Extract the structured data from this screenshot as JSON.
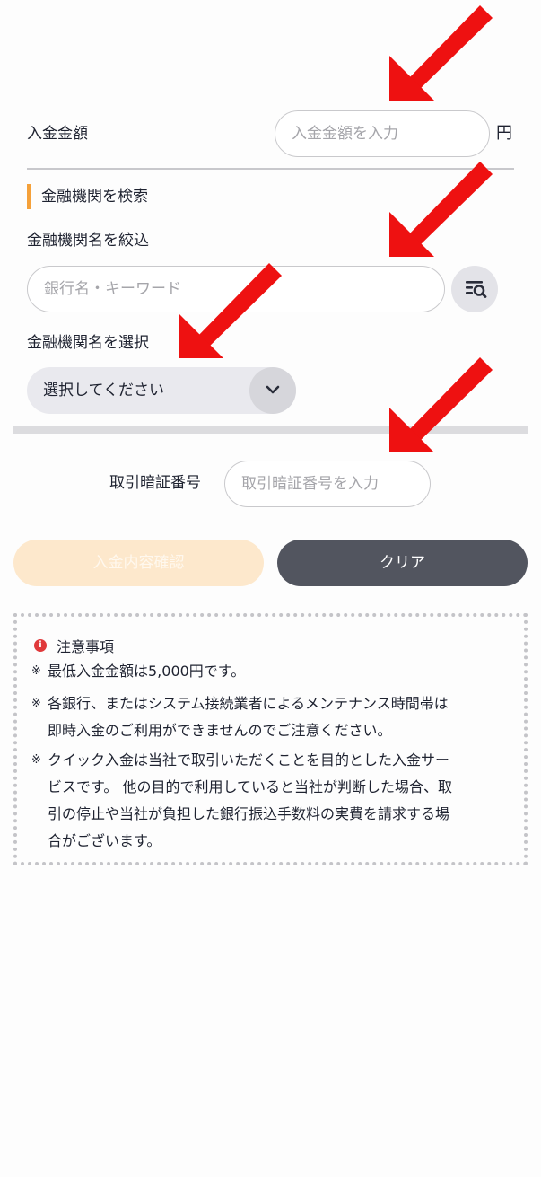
{
  "deposit": {
    "label": "入金金額",
    "placeholder": "入金金額を入力",
    "unit": "円"
  },
  "bank_search": {
    "section_title": "金融機関を検索",
    "filter_label": "金融機関名を絞込",
    "filter_placeholder": "銀行名・キーワード",
    "search_icon": "search-list-icon",
    "select_label": "金融機関名を選択",
    "select_value": "選択してください",
    "select_icon": "chevron-down-icon"
  },
  "pin": {
    "label": "取引暗証番号",
    "placeholder": "取引暗証番号を入力"
  },
  "buttons": {
    "confirm": "入金内容確認",
    "clear": "クリア"
  },
  "notice": {
    "title": "注意事項",
    "icon": "info-icon",
    "mark": "※",
    "items": [
      [
        "最低入金金額は5,000円です。"
      ],
      [
        "各銀行、またはシステム接続業者によるメンテナンス時間帯は",
        "即時入金のご利用ができませんのでご注意ください。"
      ],
      [
        "クイック入金は当社で取引いただくことを目的とした入金サー",
        "ビスです。 他の目的で利用していると当社が判断した場合、取",
        "引の停止や当社が負担した銀行振込手数料の実費を請求する場",
        "合がございます。"
      ]
    ]
  },
  "colors": {
    "accent": "#f5a13a",
    "confirm_button": "#fde8cc",
    "clear_button": "#52555f",
    "annotation_arrow": "#ee1111"
  }
}
